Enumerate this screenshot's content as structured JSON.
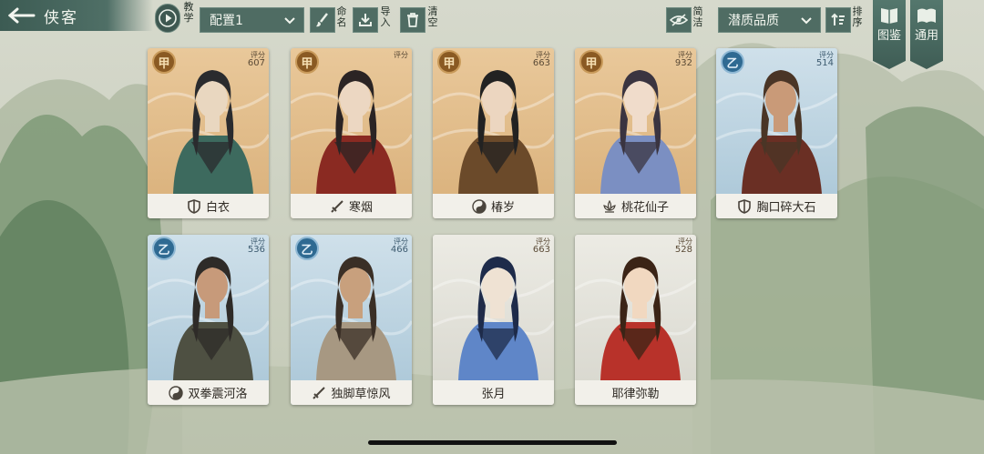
{
  "header": {
    "title": "侠客",
    "tutorial_label": "教学",
    "config_select": "配置1",
    "rename_label": "命名",
    "import_label": "导入",
    "clear_label": "清空",
    "simple_label": "简洁",
    "quality_select": "潜质品质",
    "sort_label": "排序"
  },
  "banners": {
    "codex_label": "图鉴",
    "general_label": "通用"
  },
  "score_label": "评分",
  "cards": [
    {
      "name": "白衣",
      "grade": "甲",
      "tier": "jia",
      "score": "607",
      "faction_icon": "shield-icon"
    },
    {
      "name": "寒烟",
      "grade": "甲",
      "tier": "jia",
      "score": "",
      "faction_icon": "sword-icon"
    },
    {
      "name": "椿岁",
      "grade": "甲",
      "tier": "jia",
      "score": "663",
      "faction_icon": "taiji-icon"
    },
    {
      "name": "桃花仙子",
      "grade": "甲",
      "tier": "jia",
      "score": "932",
      "faction_icon": "lotus-icon"
    },
    {
      "name": "胸口碎大石",
      "grade": "乙",
      "tier": "yi",
      "score": "514",
      "faction_icon": "shield-icon"
    },
    {
      "name": "双拳震河洛",
      "grade": "乙",
      "tier": "yi",
      "score": "536",
      "faction_icon": "taiji-icon"
    },
    {
      "name": "独脚草惊风",
      "grade": "乙",
      "tier": "yi",
      "score": "466",
      "faction_icon": "sword-icon"
    },
    {
      "name": "张月",
      "grade": "",
      "tier": "none",
      "score": "663",
      "faction_icon": ""
    },
    {
      "name": "耶律弥勒",
      "grade": "",
      "tier": "none",
      "score": "528",
      "faction_icon": ""
    }
  ]
}
